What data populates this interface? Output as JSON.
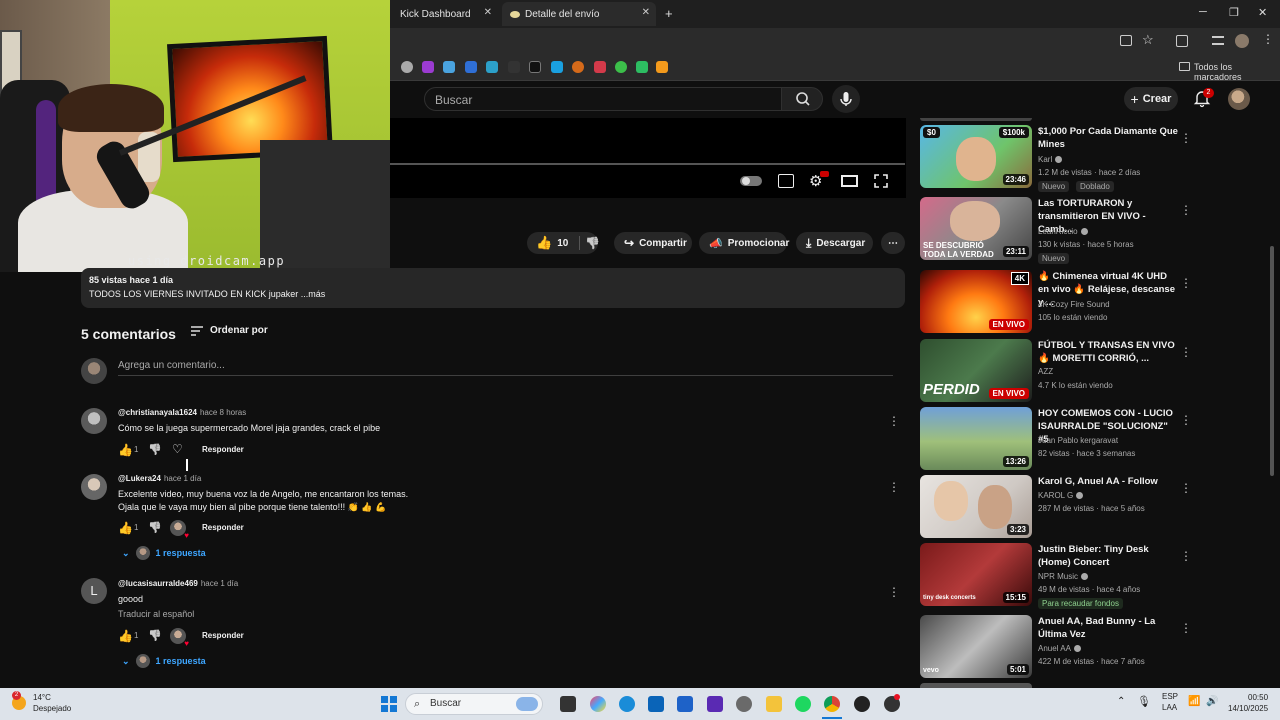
{
  "browser": {
    "tabs": [
      {
        "label": "Kick Dashboard"
      },
      {
        "label": "Detalle del envío"
      }
    ],
    "bookmarks_label": "Todos los marcadores"
  },
  "webcam": {
    "watermark": "using droidcam.app"
  },
  "yt_header": {
    "search_placeholder": "Buscar",
    "create_label": "Crear",
    "notifications_count": "2"
  },
  "actions": {
    "likes": "10",
    "share": "Compartir",
    "promote": "Promocionar",
    "download": "Descargar"
  },
  "description": {
    "meta": "85 vistas  hace 1 día",
    "text": "TODOS LOS VIERNES INVITADO EN KICK jupaker ...más"
  },
  "comments": {
    "count_label": "5 comentarios",
    "sort_label": "Ordenar por",
    "add_placeholder": "Agrega un comentario...",
    "items": [
      {
        "author": "@christianayala1624",
        "time": "hace 8 horas",
        "text": "Cómo se la juega supermercado Morel jaja grandes, crack el pibe",
        "likes": "1",
        "reply": "Responder"
      },
      {
        "author": "@Lukera24",
        "time": "hace 1 día",
        "text": "Excelente video, muy buena voz la de Angelo, me encantaron los temas.",
        "text2": "Ojala que le vaya muy bien al pibe porque tiene talento!!! 👏 👍 💪",
        "likes": "1",
        "reply": "Responder",
        "replies": "1 respuesta"
      },
      {
        "author": "@lucasisaurralde469",
        "time": "hace 1 día",
        "text": "goood",
        "translate": "Traducir al español",
        "likes": "1",
        "reply": "Responder",
        "replies": "1 respuesta",
        "avatar_letter": "L"
      }
    ]
  },
  "sidebar": [
    {
      "title": "$1,000 Por Cada Diamante Que Mines",
      "channel": "Karl",
      "meta": "1.2 M de vistas · hace 2 días",
      "badge1": "Nuevo",
      "badge2": "Doblado",
      "duration": "23:46",
      "thumb_text": "$0",
      "thumb_text2": "$100k"
    },
    {
      "title": "Las TORTURARON y transmitieron EN VIVO - Camb...",
      "channel": "LeanRiccio",
      "meta": "130 k vistas · hace 5 horas",
      "badge1": "Nuevo",
      "duration": "23:11",
      "thumb_text": "SE DESCUBRIÓ TODA LA VERDAD"
    },
    {
      "title": "🔥 Chimenea virtual 4K UHD en vivo 🔥 Relájese, descanse y ...",
      "channel": "4K Cozy Fire Sound",
      "meta": "105 lo están viendo",
      "live": "EN VIVO",
      "thumb_text": "4K"
    },
    {
      "title": "FÚTBOL Y TRANSAS EN VIVO 🔥 MORETTI CORRIÓ, ...",
      "channel": "AZZ",
      "meta": "4.7 K lo están viendo",
      "live": "EN VIVO",
      "thumb_text": "PERDID"
    },
    {
      "title": "HOY COMEMOS CON - LUCIO ISAURRALDE \"SOLUCIONZ\" #5",
      "channel": "Juan Pablo kergaravat",
      "meta": "82 vistas · hace 3 semanas",
      "duration": "13:26"
    },
    {
      "title": "Karol G, Anuel AA - Follow",
      "channel": "KAROL G",
      "meta": "287 M de vistas · hace 5 años",
      "duration": "3:23"
    },
    {
      "title": "Justin Bieber: Tiny Desk (Home) Concert",
      "channel": "NPR Music",
      "meta": "49 M de vistas · hace 4 años",
      "fund": "Para recaudar fondos",
      "duration": "15:15",
      "thumb_text": "tiny desk concerts"
    },
    {
      "title": "Anuel AA, Bad Bunny - La Última Vez",
      "channel": "Anuel AA",
      "meta": "422 M de vistas · hace 7 años",
      "duration": "5:01",
      "thumb_text": "vevo"
    }
  ],
  "taskbar": {
    "temp": "14°C",
    "weather": "Despejado",
    "search": "Buscar",
    "lang1": "ESP",
    "lang2": "LAA",
    "time": "00:50",
    "date": "14/10/2025",
    "badge": "2"
  }
}
